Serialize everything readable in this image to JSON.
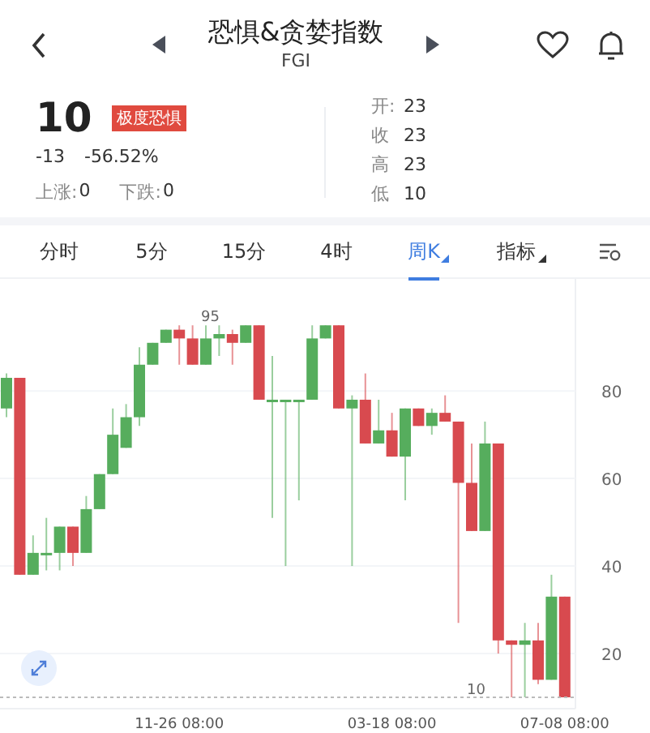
{
  "header": {
    "title": "恐惧&贪婪指数",
    "subtitle": "FGI"
  },
  "quote": {
    "value": "10",
    "tag": "极度恐惧",
    "change": "-13",
    "change_percent": "-56.52%",
    "stats": [
      {
        "label": "上涨:",
        "value": "0"
      },
      {
        "label": "下跌:",
        "value": "0"
      }
    ],
    "ohlc": [
      {
        "label": "开:",
        "value": "23"
      },
      {
        "label": "收",
        "value": "23"
      },
      {
        "label": "高",
        "value": "23"
      },
      {
        "label": "低",
        "value": "10"
      }
    ]
  },
  "tabs": [
    {
      "label": "分时",
      "selected": false,
      "menu": false
    },
    {
      "label": "5分",
      "selected": false,
      "menu": false
    },
    {
      "label": "15分",
      "selected": false,
      "menu": false
    },
    {
      "label": "4时",
      "selected": false,
      "menu": false
    },
    {
      "label": "周K",
      "selected": true,
      "menu": true
    },
    {
      "label": "指标",
      "selected": false,
      "menu": true
    }
  ],
  "chart": {
    "high_marker": "95",
    "chart_data": {
      "type": "candlestick",
      "categories": [
        null,
        null,
        null,
        null,
        null,
        null,
        null,
        null,
        null,
        null,
        null,
        null,
        null,
        "11-26 08:00",
        null,
        null,
        null,
        null,
        null,
        null,
        null,
        null,
        null,
        null,
        null,
        null,
        null,
        null,
        null,
        "03-18 08:00",
        null,
        null,
        null,
        null,
        null,
        null,
        null,
        null,
        null,
        null,
        null,
        null,
        "07-08 08:00"
      ],
      "ohlc": [
        [
          76,
          84,
          74,
          83
        ],
        [
          83,
          83,
          38,
          38
        ],
        [
          38,
          47,
          38,
          43
        ],
        [
          43,
          51,
          39,
          43
        ],
        [
          43,
          49,
          39,
          49
        ],
        [
          49,
          49,
          40,
          43
        ],
        [
          43,
          56,
          43,
          53
        ],
        [
          53,
          61,
          53,
          61
        ],
        [
          61,
          76,
          61,
          70
        ],
        [
          67,
          77,
          67,
          74
        ],
        [
          74,
          90,
          72,
          86
        ],
        [
          86,
          91,
          86,
          91
        ],
        [
          91,
          94,
          91,
          94
        ],
        [
          94,
          95,
          86,
          92
        ],
        [
          92,
          95,
          86,
          86
        ],
        [
          86,
          95,
          86,
          92
        ],
        [
          92,
          95,
          88,
          93
        ],
        [
          93,
          94,
          86,
          91
        ],
        [
          91,
          95,
          91,
          95
        ],
        [
          95,
          95,
          78,
          78
        ],
        [
          78,
          88,
          51,
          78
        ],
        [
          78,
          78,
          40,
          78
        ],
        [
          78,
          78,
          55,
          78
        ],
        [
          78,
          95,
          78,
          92
        ],
        [
          92,
          95,
          92,
          95
        ],
        [
          95,
          95,
          76,
          76
        ],
        [
          76,
          79,
          40,
          78
        ],
        [
          78,
          84,
          68,
          68
        ],
        [
          68,
          78,
          68,
          71
        ],
        [
          71,
          75,
          65,
          65
        ],
        [
          65,
          76,
          55,
          76
        ],
        [
          76,
          76,
          72,
          72
        ],
        [
          72,
          76,
          70,
          75
        ],
        [
          75,
          79,
          73,
          73
        ],
        [
          73,
          73,
          27,
          59
        ],
        [
          59,
          68,
          48,
          48
        ],
        [
          48,
          73,
          48,
          68
        ],
        [
          68,
          68,
          20,
          23
        ],
        [
          23,
          23,
          10,
          22
        ],
        [
          22,
          27,
          10,
          23
        ],
        [
          23,
          27,
          13,
          14
        ],
        [
          14,
          38,
          14,
          33
        ],
        [
          33,
          33,
          10,
          10
        ]
      ],
      "ylim": [
        7.4,
        105.6
      ],
      "yticks": [
        20,
        40,
        60,
        80
      ],
      "grid": true,
      "ref_lines": [
        {
          "axis": "y",
          "value": 10,
          "label": "10"
        }
      ]
    }
  }
}
